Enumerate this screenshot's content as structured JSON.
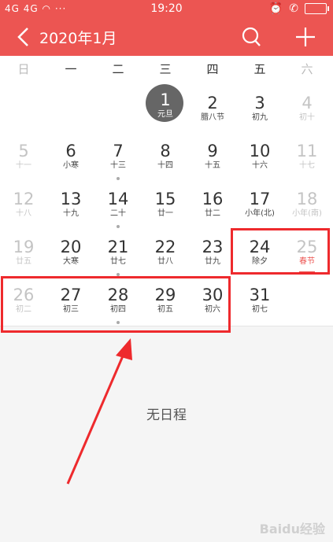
{
  "status_bar": {
    "signal": "4G 4G",
    "dots": "···",
    "time": "19:20"
  },
  "header": {
    "title": "2020年1月"
  },
  "weekdays": [
    "日",
    "一",
    "二",
    "三",
    "四",
    "五",
    "六"
  ],
  "days": [
    {
      "n": "1",
      "l": "元旦"
    },
    {
      "n": "2",
      "l": "腊八节"
    },
    {
      "n": "3",
      "l": "初九"
    },
    {
      "n": "4",
      "l": "初十"
    },
    {
      "n": "5",
      "l": "十一"
    },
    {
      "n": "6",
      "l": "小寒"
    },
    {
      "n": "7",
      "l": "十三"
    },
    {
      "n": "8",
      "l": "十四"
    },
    {
      "n": "9",
      "l": "十五"
    },
    {
      "n": "10",
      "l": "十六"
    },
    {
      "n": "11",
      "l": "十七"
    },
    {
      "n": "12",
      "l": "十八"
    },
    {
      "n": "13",
      "l": "十九"
    },
    {
      "n": "14",
      "l": "二十"
    },
    {
      "n": "15",
      "l": "廿一"
    },
    {
      "n": "16",
      "l": "廿二"
    },
    {
      "n": "17",
      "l": "小年(北)"
    },
    {
      "n": "18",
      "l": "小年(南)"
    },
    {
      "n": "19",
      "l": "廿五"
    },
    {
      "n": "20",
      "l": "大寒"
    },
    {
      "n": "21",
      "l": "廿七"
    },
    {
      "n": "22",
      "l": "廿八"
    },
    {
      "n": "23",
      "l": "廿九"
    },
    {
      "n": "24",
      "l": "除夕"
    },
    {
      "n": "25",
      "l": "春节"
    },
    {
      "n": "26",
      "l": "初二"
    },
    {
      "n": "27",
      "l": "初三"
    },
    {
      "n": "28",
      "l": "初四"
    },
    {
      "n": "29",
      "l": "初五"
    },
    {
      "n": "30",
      "l": "初六"
    },
    {
      "n": "31",
      "l": "初七"
    }
  ],
  "empty_text": "无日程",
  "watermark": "Baidu经验",
  "colors": {
    "accent": "#ec5552",
    "highlight": "#ee2a2d",
    "today": "#666666"
  }
}
